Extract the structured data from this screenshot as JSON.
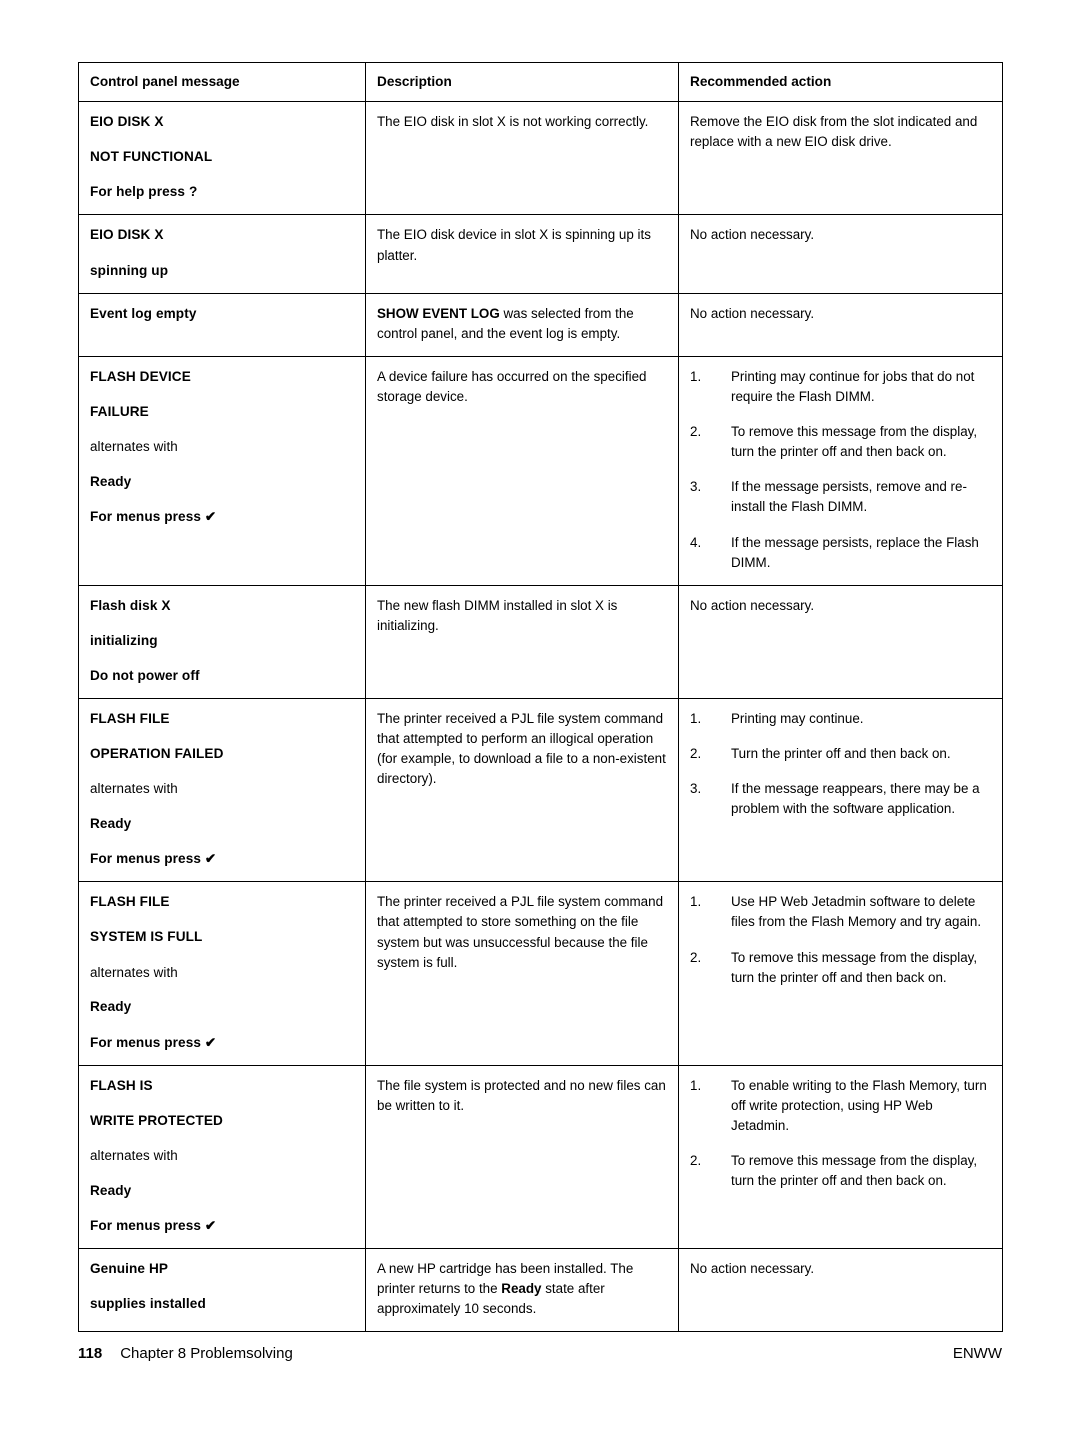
{
  "table": {
    "headers": [
      "Control panel message",
      "Description",
      "Recommended action"
    ],
    "rows": [
      {
        "message_lines": [
          {
            "text": "EIO DISK X",
            "bold": true
          },
          {
            "text": "NOT FUNCTIONAL",
            "bold": true
          },
          {
            "text": "For help press ?",
            "bold": true
          }
        ],
        "description": "The EIO disk in slot X is not working correctly.",
        "action_type": "paragraph",
        "action": "Remove the EIO disk from the slot indicated and replace with a new EIO disk drive."
      },
      {
        "message_lines": [
          {
            "text": "EIO DISK X",
            "bold": true
          },
          {
            "text": "spinning up",
            "bold": true
          }
        ],
        "description": "The EIO disk device in slot X is spinning up its platter.",
        "action_type": "paragraph",
        "action": "No action necessary."
      },
      {
        "message_lines": [
          {
            "text": "Event log empty",
            "bold": true
          }
        ],
        "description_rich": [
          {
            "text": "SHOW EVENT LOG",
            "bold": true
          },
          {
            "text": " was selected from the control panel, and the event log is empty.",
            "bold": false
          }
        ],
        "description": "SHOW EVENT LOG was selected from the control panel, and the event log is empty.",
        "action_type": "paragraph",
        "action": "No action necessary."
      },
      {
        "message_lines": [
          {
            "text": "FLASH DEVICE",
            "bold": true
          },
          {
            "text": "FAILURE",
            "bold": true
          },
          {
            "text": "alternates with",
            "bold": false
          },
          {
            "text": "Ready",
            "bold": true
          },
          {
            "text": "For menus press ✔",
            "bold": true
          }
        ],
        "description": "A device failure has occurred on the specified storage device.",
        "action_type": "list",
        "action_items": [
          "Printing may continue for jobs that do not require the Flash DIMM.",
          "To remove this message from the display, turn the printer off and then back on.",
          "If the message persists, remove and re-install the Flash DIMM.",
          "If the message persists, replace the Flash DIMM."
        ]
      },
      {
        "message_lines": [
          {
            "text": "Flash disk X",
            "bold": true
          },
          {
            "text": "initializing",
            "bold": true
          },
          {
            "text": "Do not power off",
            "bold": true
          }
        ],
        "description": "The new flash DIMM installed in slot X is initializing.",
        "action_type": "paragraph",
        "action": "No action necessary."
      },
      {
        "message_lines": [
          {
            "text": "FLASH FILE",
            "bold": true
          },
          {
            "text": "OPERATION FAILED",
            "bold": true
          },
          {
            "text": "alternates with",
            "bold": false
          },
          {
            "text": "Ready",
            "bold": true
          },
          {
            "text": "For menus press ✔",
            "bold": true
          }
        ],
        "description": "The printer received a PJL file system command that attempted to perform an illogical operation (for example, to download a file to a non-existent directory).",
        "action_type": "list",
        "action_items": [
          "Printing may continue.",
          "Turn the printer off and then back on.",
          "If the message reappears, there may be a problem with the software application."
        ]
      },
      {
        "message_lines": [
          {
            "text": "FLASH FILE",
            "bold": true
          },
          {
            "text": "SYSTEM IS FULL",
            "bold": true
          },
          {
            "text": "alternates with",
            "bold": false
          },
          {
            "text": "Ready",
            "bold": true
          },
          {
            "text": "For menus press ✔",
            "bold": true
          }
        ],
        "description": "The printer received a PJL file system command that attempted to store something on the file system but was unsuccessful because the file system is full.",
        "action_type": "list",
        "action_items": [
          "Use HP Web Jetadmin software to delete files from the Flash Memory and try again.",
          "To remove this message from the display, turn the printer off and then back on."
        ]
      },
      {
        "message_lines": [
          {
            "text": "FLASH IS",
            "bold": true
          },
          {
            "text": "WRITE PROTECTED",
            "bold": true
          },
          {
            "text": "alternates with",
            "bold": false
          },
          {
            "text": "Ready",
            "bold": true
          },
          {
            "text": "For menus press ✔",
            "bold": true
          }
        ],
        "description": "The file system is protected and no new files can be written to it.",
        "action_type": "list",
        "action_items": [
          "To enable writing to the Flash Memory, turn off write protection, using HP Web Jetadmin.",
          "To remove this message from the display, turn the printer off and then back on."
        ]
      },
      {
        "message_lines": [
          {
            "text": "Genuine HP",
            "bold": true
          },
          {
            "text": "supplies installed",
            "bold": true
          }
        ],
        "description_rich": [
          {
            "text": "A new HP cartridge has been installed. The printer returns to the ",
            "bold": false
          },
          {
            "text": "Ready",
            "bold": true
          },
          {
            "text": " state after approximately 10 seconds.",
            "bold": false
          }
        ],
        "description": "A new HP cartridge has been installed. The printer returns to the Ready state after approximately 10 seconds.",
        "action_type": "paragraph",
        "action": "No action necessary."
      }
    ]
  },
  "footer": {
    "page_number": "118",
    "chapter": "Chapter 8  Problemsolving",
    "right": "ENWW"
  }
}
